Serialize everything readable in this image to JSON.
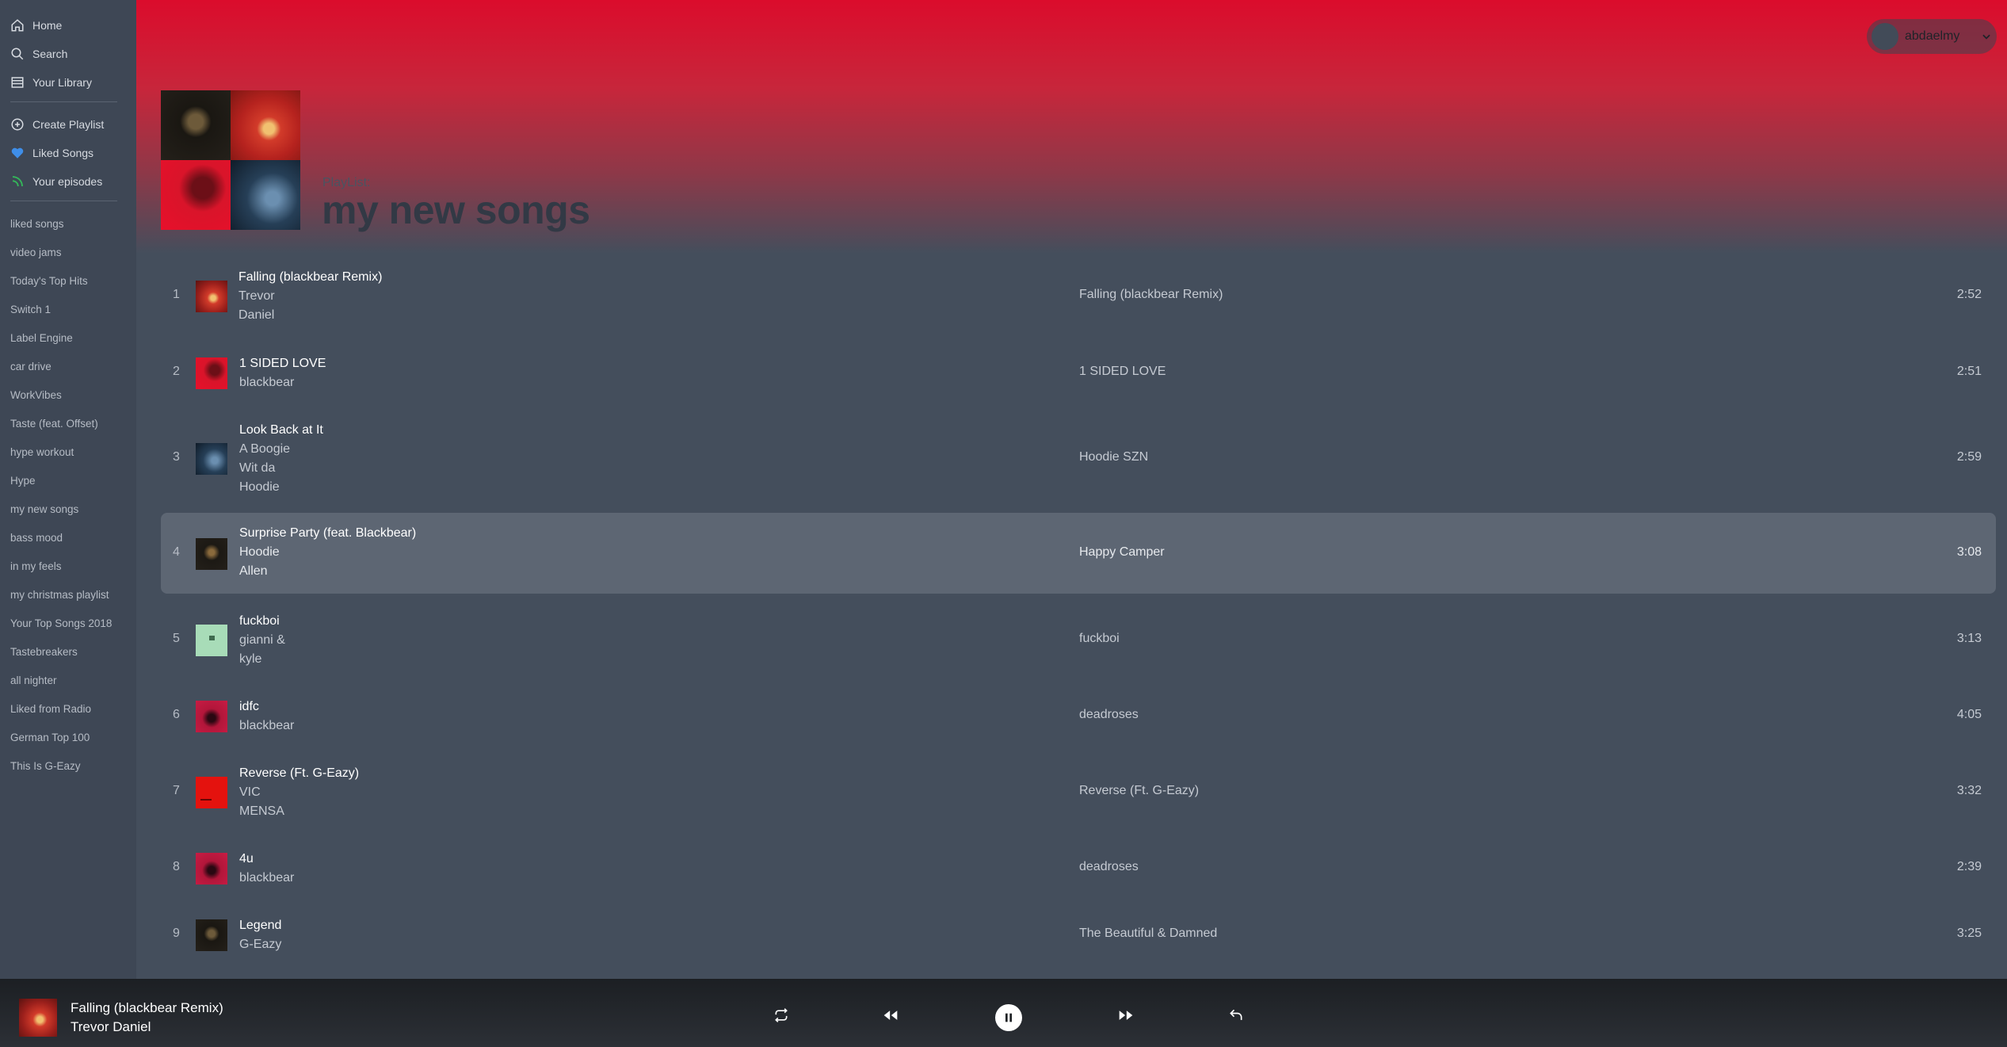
{
  "sidebar": {
    "nav": [
      {
        "label": "Home",
        "icon": "home-icon"
      },
      {
        "label": "Search",
        "icon": "search-icon"
      },
      {
        "label": "Your Library",
        "icon": "library-icon"
      }
    ],
    "actions": [
      {
        "label": "Create Playlist",
        "icon": "plus-circle-icon"
      },
      {
        "label": "Liked Songs",
        "icon": "heart-icon",
        "color": "#3f8ee8"
      },
      {
        "label": "Your episodes",
        "icon": "rss-icon",
        "color": "#34b75a"
      }
    ],
    "playlists": [
      "liked songs",
      "video jams",
      "Today's Top Hits",
      "Switch 1",
      "Label Engine",
      "car drive",
      "WorkVibes",
      "Taste (feat. Offset)",
      "hype workout",
      "Hype",
      "my new songs",
      "bass mood",
      "in my feels",
      "my christmas playlist",
      "Your Top Songs 2018",
      "Tastebreakers",
      "all nighter",
      "Liked from Radio",
      "German Top 100",
      "This Is G-Eazy"
    ]
  },
  "user": {
    "name": "abdaelmy"
  },
  "playlist": {
    "label": "PlayList:",
    "title": "my new songs"
  },
  "tracks": [
    {
      "num": "1",
      "title": "Falling (blackbear Remix)",
      "artists": [
        "Trevor",
        "Daniel"
      ],
      "album": "Falling (blackbear Remix)",
      "duration": "2:52"
    },
    {
      "num": "2",
      "title": "1 SIDED LOVE",
      "artists": [
        "blackbear"
      ],
      "album": "1 SIDED LOVE",
      "duration": "2:51"
    },
    {
      "num": "3",
      "title": "Look Back at It",
      "artists": [
        "A Boogie",
        "Wit da",
        "Hoodie"
      ],
      "album": "Hoodie SZN",
      "duration": "2:59"
    },
    {
      "num": "4",
      "title": "Surprise Party (feat. Blackbear)",
      "artists": [
        "Hoodie",
        "Allen"
      ],
      "album": "Happy Camper",
      "duration": "3:08"
    },
    {
      "num": "5",
      "title": "fuckboi",
      "artists": [
        "gianni &",
        "kyle"
      ],
      "album": "fuckboi",
      "duration": "3:13"
    },
    {
      "num": "6",
      "title": "idfc",
      "artists": [
        "blackbear"
      ],
      "album": "deadroses",
      "duration": "4:05"
    },
    {
      "num": "7",
      "title": "Reverse (Ft. G-Eazy)",
      "artists": [
        "VIC",
        "MENSA"
      ],
      "album": "Reverse (Ft. G-Eazy)",
      "duration": "3:32"
    },
    {
      "num": "8",
      "title": "4u",
      "artists": [
        "blackbear"
      ],
      "album": "deadroses",
      "duration": "2:39"
    },
    {
      "num": "9",
      "title": "Legend",
      "artists": [
        "G-Eazy"
      ],
      "album": "The Beautiful & Damned",
      "duration": "3:25"
    }
  ],
  "now_playing": {
    "title": "Falling (blackbear Remix)",
    "artist": "Trevor Daniel"
  },
  "controls": [
    "repeat-icon",
    "previous-icon",
    "pause-icon",
    "next-icon",
    "undo-icon"
  ]
}
